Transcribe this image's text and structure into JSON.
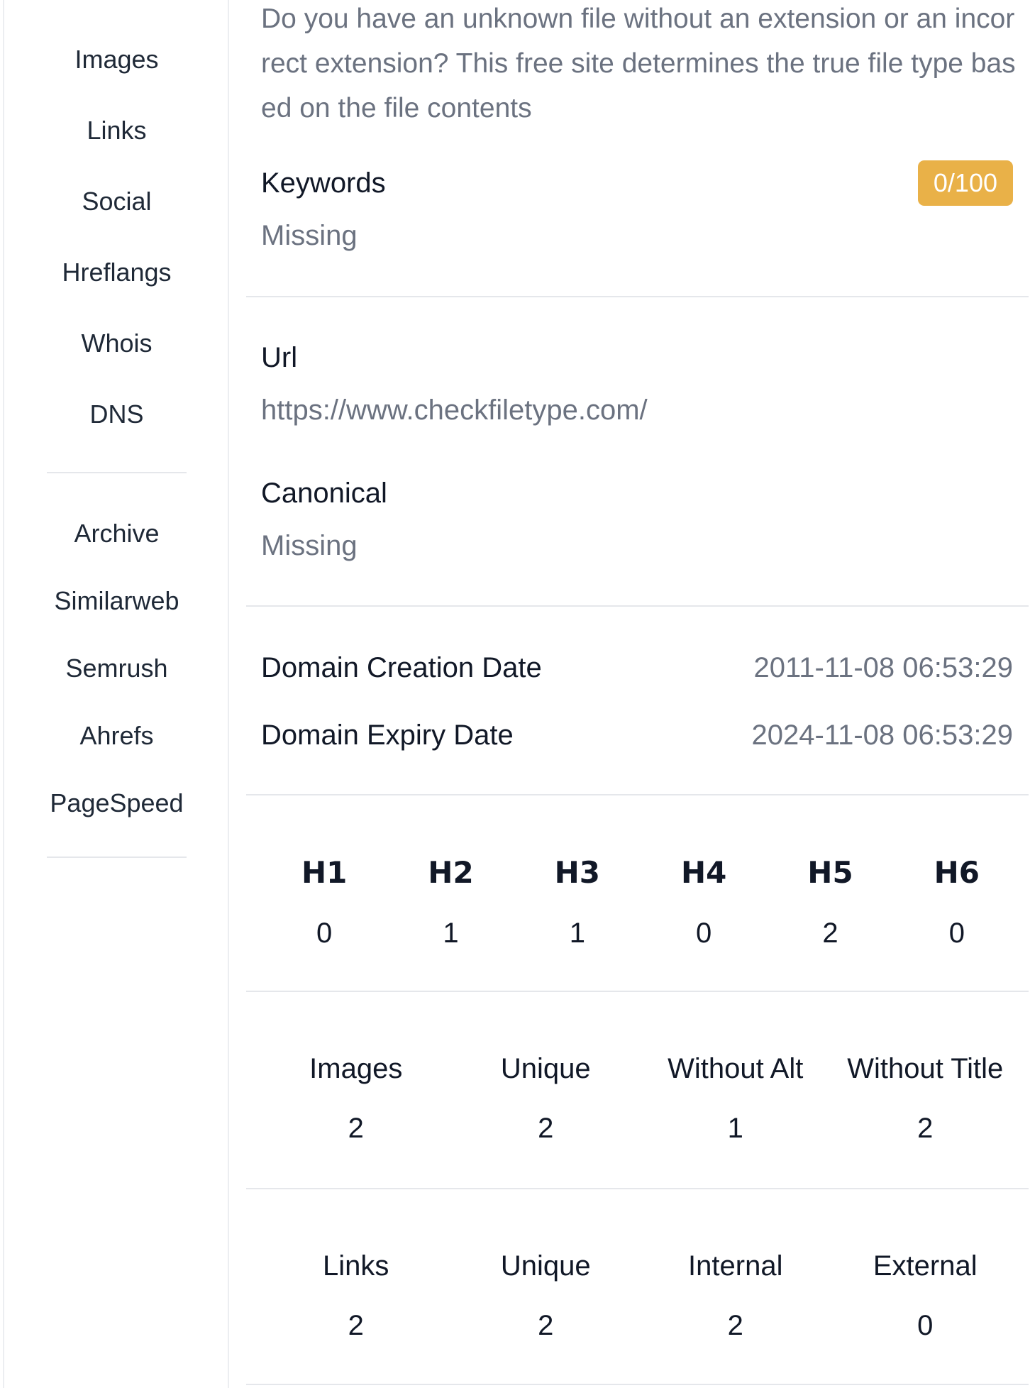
{
  "sidebar": {
    "items_top": [
      {
        "label": "Images"
      },
      {
        "label": "Links"
      },
      {
        "label": "Social"
      },
      {
        "label": "Hreflangs"
      },
      {
        "label": "Whois"
      },
      {
        "label": "DNS"
      }
    ],
    "items_bottom": [
      {
        "label": "Archive"
      },
      {
        "label": "Similarweb"
      },
      {
        "label": "Semrush"
      },
      {
        "label": "Ahrefs"
      },
      {
        "label": "PageSpeed"
      }
    ]
  },
  "main": {
    "description": "Do you have an unknown file without an extension or an incorrect extension? This free site determines the true file type based on the file contents",
    "keywords": {
      "label": "Keywords",
      "value": "Missing",
      "score": "0/100",
      "score_color": "#e9b148"
    },
    "url": {
      "label": "Url",
      "value": "https://www.checkfiletype.com/"
    },
    "canonical": {
      "label": "Canonical",
      "value": "Missing"
    },
    "domain_creation": {
      "label": "Domain Creation Date",
      "value": "2011-11-08 06:53:29"
    },
    "domain_expiry": {
      "label": "Domain Expiry Date",
      "value": "2024-11-08 06:53:29"
    },
    "headings": [
      {
        "label": "H1",
        "value": "0"
      },
      {
        "label": "H2",
        "value": "1"
      },
      {
        "label": "H3",
        "value": "1"
      },
      {
        "label": "H4",
        "value": "0"
      },
      {
        "label": "H5",
        "value": "2"
      },
      {
        "label": "H6",
        "value": "0"
      }
    ],
    "images_stats": [
      {
        "label": "Images",
        "value": "2"
      },
      {
        "label": "Unique",
        "value": "2"
      },
      {
        "label": "Without Alt",
        "value": "1"
      },
      {
        "label": "Without Title",
        "value": "2"
      }
    ],
    "links_stats": [
      {
        "label": "Links",
        "value": "2"
      },
      {
        "label": "Unique",
        "value": "2"
      },
      {
        "label": "Internal",
        "value": "2"
      },
      {
        "label": "External",
        "value": "0"
      }
    ]
  }
}
